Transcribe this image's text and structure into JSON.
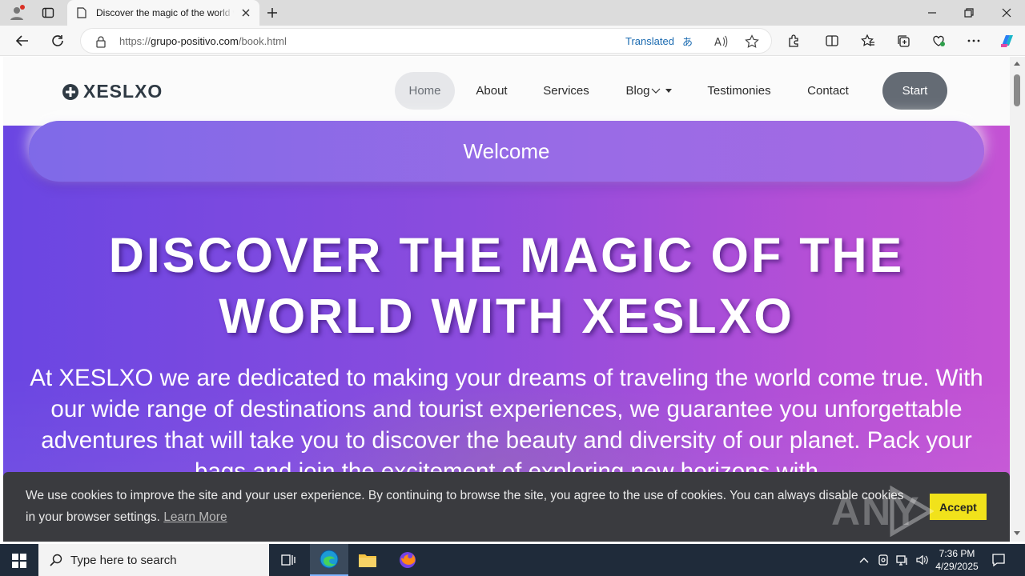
{
  "browser": {
    "tab_title": "Discover the magic of the world with XESLXO",
    "url_prefix": "https://",
    "url_host": "grupo-positivo.com",
    "url_path": "/book.html",
    "translated_label": "Translated"
  },
  "site": {
    "logo_text": "XESLXO",
    "nav": [
      {
        "label": "Home",
        "active": true
      },
      {
        "label": "About"
      },
      {
        "label": "Services"
      },
      {
        "label": "Blog"
      },
      {
        "label": "Testimonies"
      },
      {
        "label": "Contact"
      }
    ],
    "start_label": "Start"
  },
  "hero": {
    "welcome": "Welcome",
    "title": "DISCOVER THE MAGIC OF THE WORLD WITH XESLXO",
    "text": "At XESLXO we are dedicated to making your dreams of traveling the world come true. With our wide range of destinations and tourist experiences, we guarantee you unforgettable adventures that will take you to discover the beauty and diversity of our planet. Pack your bags and join the excitement of exploring new horizons with"
  },
  "cookie": {
    "text": "We use cookies to improve the site and your user experience. By continuing to browse the site, you agree to the use of cookies. You can always disable cookies in your browser settings.",
    "learn_more": "Learn More",
    "accept": "Accept"
  },
  "watermark": "ANY RUN",
  "taskbar": {
    "search_placeholder": "Type here to search",
    "time": "7:36 PM",
    "date": "4/29/2025"
  },
  "colors": {
    "accent": "#6a46e2",
    "accept_button": "#f1e21b",
    "start_button": "#646b74"
  }
}
